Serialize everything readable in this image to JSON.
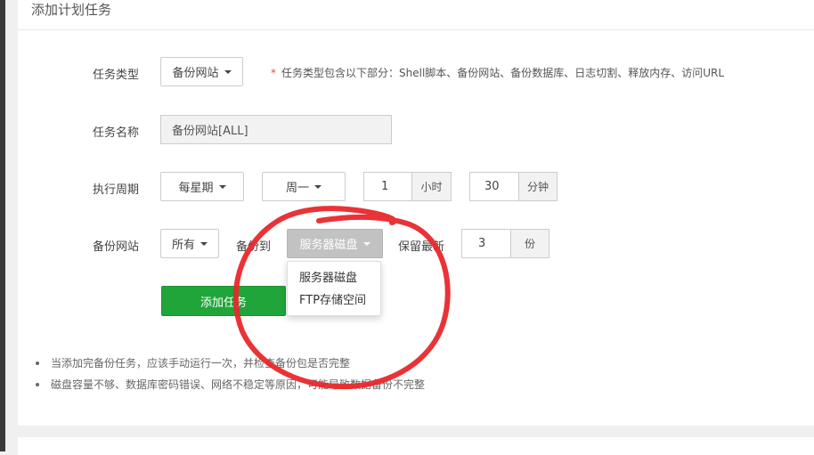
{
  "page_title": "添加计划任务",
  "form": {
    "task_type": {
      "label": "任务类型",
      "value": "备份网站",
      "note_star": "*",
      "note": "任务类型包含以下部分：Shell脚本、备份网站、备份数据库、日志切割、释放内存、访问URL"
    },
    "task_name": {
      "label": "任务名称",
      "value": "备份网站[ALL]"
    },
    "cycle": {
      "label": "执行周期",
      "period": "每星期",
      "weekday": "周一",
      "hour": "1",
      "hour_unit": "小时",
      "minute": "30",
      "minute_unit": "分钟"
    },
    "backup_site": {
      "label": "备份网站",
      "site": "所有",
      "backup_to_label": "备份到",
      "backup_to": "服务器磁盘",
      "keep_label": "保留最新",
      "keep_count": "3",
      "keep_unit": "份"
    },
    "dropdown_options": [
      "服务器磁盘",
      "FTP存储空间"
    ],
    "submit_label": "添加任务"
  },
  "tips": [
    "当添加完备份任务，应该手动运行一次，并检查备份包是否完整",
    "磁盘容量不够、数据库密码错误、网络不稳定等原因，可能导致数据备份不完整"
  ],
  "colors": {
    "primary_green": "#20a53a",
    "annotation_red": "#e8282c",
    "note_star": "#e24c4c"
  },
  "icons": {
    "dropdown_caret": "caret-down-icon"
  }
}
